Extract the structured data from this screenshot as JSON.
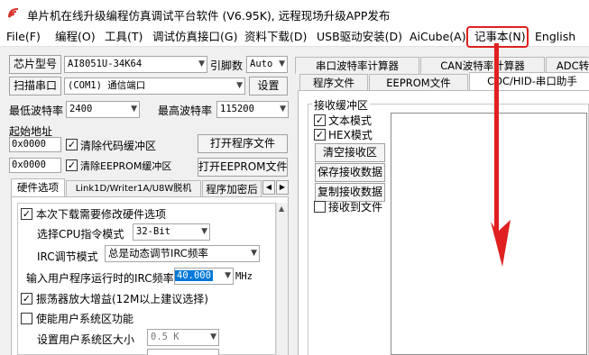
{
  "window": {
    "title": "单片机在线升级编程仿真调试平台软件 (V6.95K), 远程现场升级APP发布"
  },
  "menu": [
    "File(F)",
    "编程(O)",
    "工具(T)",
    "调试仿真接口(G)",
    "资料下载(D)",
    "USB驱动安装(D)",
    "AiCube(A)",
    "记事本(N)",
    "English"
  ],
  "left": {
    "chip_label": "芯片型号",
    "chip_value": "AI8051U-34K64",
    "pin_label": "引脚数",
    "pin_value": "Auto",
    "scan_label": "扫描串口",
    "port_value": "(COM1) 通信端口",
    "settings_label": "设置",
    "min_baud_label": "最低波特率",
    "min_baud_value": "2400",
    "max_baud_label": "最高波特率",
    "max_baud_value": "115200",
    "start_addr_label": "起始地址",
    "addr1": "0x0000",
    "clear_code_label": "清除代码缓冲区",
    "open_prog_label": "打开程序文件",
    "addr2": "0x0000",
    "clear_eeprom_label": "清除EEPROM缓冲区",
    "open_eeprom_label": "打开EEPROM文件",
    "tabs": [
      "硬件选项",
      "Link1D/Writer1A/U8W脱机",
      "程序加密后"
    ],
    "hw": {
      "modify_label": "本次下载需要修改硬件选项",
      "cpu_mode_label": "选择CPU指令模式",
      "cpu_mode_value": "32-Bit",
      "irc_mode_label": "IRC调节模式",
      "irc_mode_value": "总是动态调节IRC频率",
      "freq_label": "输入用户程序运行时的IRC频率",
      "freq_value": "40.000",
      "freq_unit": "MHz",
      "osc_label": "振荡器放大增益(12M以上建议选择)",
      "sys_area_label": "使能用户系统区功能",
      "sys_area_size_label": "设置用户系统区大小",
      "sys_area_size_value": "0.5 K"
    }
  },
  "right": {
    "tabs_row1": [
      "串口波特率计算器",
      "CAN波特率计算器",
      "ADC转"
    ],
    "tabs_row2": [
      "程序文件",
      "EEPROM文件",
      "CDC/HID-串口助手"
    ],
    "recv_group_label": "接收缓冲区",
    "text_mode_label": "文本模式",
    "hex_mode_label": "HEX模式",
    "clear_recv_label": "清空接收区",
    "save_recv_label": "保存接收数据",
    "copy_recv_label": "复制接收数据",
    "recv_to_file_label": "接收到文件"
  },
  "colors": {
    "highlight": "#e02020",
    "selection": "#0078d7"
  }
}
